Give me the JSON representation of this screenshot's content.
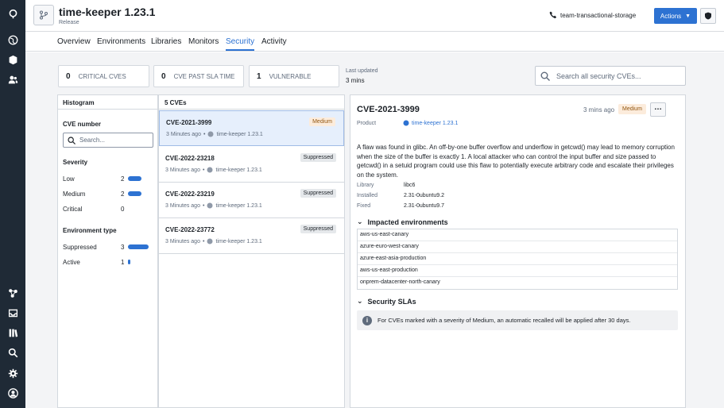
{
  "app": {
    "title": "time-keeper 1.23.1",
    "subtitle": "Release"
  },
  "header": {
    "team": "team-transactional-storage",
    "actions_label": "Actions"
  },
  "tabs": [
    "Overview",
    "Environments",
    "Libraries",
    "Monitors",
    "Security",
    "Activity"
  ],
  "active_tab": "Security",
  "stats": [
    {
      "count": "0",
      "label": "CRITICAL CVES"
    },
    {
      "count": "0",
      "label": "CVE PAST SLA TIME"
    },
    {
      "count": "1",
      "label": "VULNERABLE"
    }
  ],
  "last_updated": {
    "label": "Last updated",
    "value": "3 mins"
  },
  "search_placeholder": "Search all security CVEs...",
  "histogram": {
    "title": "Histogram",
    "cve_label": "CVE number",
    "cve_search_placeholder": "Search...",
    "severity_label": "Severity",
    "severity": [
      {
        "label": "Low",
        "count": "2",
        "fraction": 0.67
      },
      {
        "label": "Medium",
        "count": "2",
        "fraction": 0.67
      },
      {
        "label": "Critical",
        "count": "0",
        "fraction": 0
      }
    ],
    "env_label": "Environment type",
    "env": [
      {
        "label": "Suppressed",
        "count": "3",
        "fraction": 1.0
      },
      {
        "label": "Active",
        "count": "1",
        "fraction": 0.1
      }
    ]
  },
  "cve_list": {
    "header": "5 CVEs",
    "items": [
      {
        "id": "CVE-2021-3999",
        "time": "3 Minutes ago",
        "product": "time-keeper 1.23.1",
        "badge": "Medium",
        "selected": true
      },
      {
        "id": "CVE-2022-23218",
        "time": "3 Minutes ago",
        "product": "time-keeper 1.23.1",
        "badge": "Suppressed"
      },
      {
        "id": "CVE-2022-23219",
        "time": "3 Minutes ago",
        "product": "time-keeper 1.23.1",
        "badge": "Suppressed"
      },
      {
        "id": "CVE-2022-23772",
        "time": "3 Minutes ago",
        "product": "time-keeper 1.23.1",
        "badge": "Suppressed"
      }
    ]
  },
  "detail": {
    "id": "CVE-2021-3999",
    "time": "3 mins ago",
    "severity": "Medium",
    "product_label": "Product",
    "product": "time-keeper 1.23.1",
    "description": "A flaw was found in glibc. An off-by-one buffer overflow and underflow in getcwd() may lead to memory corruption when the size of the buffer is exactly 1. A local attacker who can control the input buffer and size passed to getcwd() in a setuid program could use this flaw to potentially execute arbitrary code and escalate their privileges on the system.",
    "library_label": "Library",
    "library": "libc6",
    "installed_label": "Installed",
    "installed": "2.31-0ubuntu9.2",
    "fixed_label": "Fixed",
    "fixed": "2.31-0ubuntu9.7",
    "impacted_label": "Impacted environments",
    "environments": [
      "aws-us-east-canary",
      "azure-euro-west-canary",
      "azure-east-asia-production",
      "aws-us-east-production",
      "onprem-datacenter-north-canary"
    ],
    "sla_label": "Security SLAs",
    "sla_text": "For CVEs marked with a severity of Medium, an automatic recalled will be applied after 30 days."
  },
  "colors": {
    "accent": "#2d72d2",
    "sidebar": "#1f2a36",
    "medium_bg": "#fcecdc",
    "medium_fg": "#935610"
  }
}
